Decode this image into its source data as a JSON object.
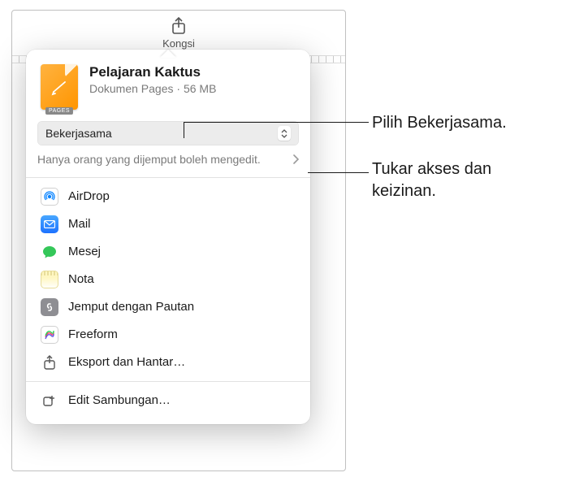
{
  "toolbar": {
    "label": "Kongsi"
  },
  "document": {
    "title": "Pelajaran Kaktus",
    "type": "Dokumen Pages",
    "size": "56 MB",
    "badge": "PAGES"
  },
  "mode": {
    "label": "Bekerjasama"
  },
  "access": {
    "description": "Hanya orang yang dijemput boleh mengedit."
  },
  "share_options": [
    {
      "name": "AirDrop"
    },
    {
      "name": "Mail"
    },
    {
      "name": "Mesej"
    },
    {
      "name": "Nota"
    },
    {
      "name": "Jemput dengan Pautan"
    },
    {
      "name": "Freeform"
    },
    {
      "name": "Eksport dan Hantar…"
    }
  ],
  "edit_extensions": "Edit Sambungan…",
  "callouts": {
    "collaborate": "Pilih Bekerjasama.",
    "access": "Tukar akses dan keizinan."
  }
}
